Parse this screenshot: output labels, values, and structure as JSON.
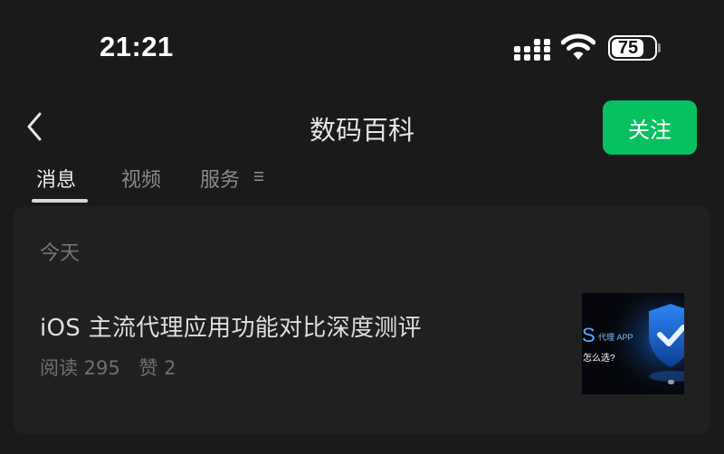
{
  "status_bar": {
    "time": "21:21",
    "battery_level": "75",
    "battery_fraction": 0.75
  },
  "nav": {
    "title": "数码百科",
    "follow_label": "关注"
  },
  "tabs": [
    {
      "label": "消息",
      "active": true
    },
    {
      "label": "视频",
      "active": false
    },
    {
      "label": "服务",
      "active": false
    }
  ],
  "tab_menu_icon": "≡",
  "feed": {
    "date_label": "今天",
    "article": {
      "title": "iOS 主流代理应用功能对比深度测评",
      "reads_label": "阅读 295",
      "likes_label": "赞 2",
      "thumbnail": {
        "big_letter": "S",
        "tag_label": "代理 APP",
        "question": "怎么选?",
        "icon": "shield-check-icon"
      }
    }
  },
  "colors": {
    "background": "#1a1a1a",
    "card": "#202020",
    "accent_green": "#07c160"
  }
}
